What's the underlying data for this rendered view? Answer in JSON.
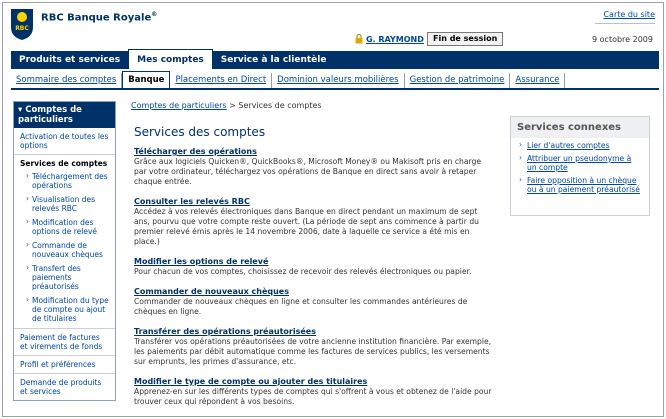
{
  "header": {
    "brand": "RBC Banque Royale",
    "brand_mark": "®",
    "logo_text": "RBC",
    "sitemap": "Carte du site",
    "user": "G. RAYMOND",
    "logout": "Fin de session",
    "date": "9 octobre 2009"
  },
  "colors": {
    "navy": "#003168",
    "link": "#0047a6",
    "logo_yellow": "#ffd200"
  },
  "main_tabs": [
    {
      "label": "Produits et services"
    },
    {
      "label": "Mes comptes"
    },
    {
      "label": "Service à la clientèle"
    }
  ],
  "sub_tabs": [
    {
      "label": "Sommaire des comptes"
    },
    {
      "label": "Banque"
    },
    {
      "label": "Placements en Direct"
    },
    {
      "label": "Dominion valeurs mobilières"
    },
    {
      "label": "Gestion de patrimoine"
    },
    {
      "label": "Assurance"
    }
  ],
  "leftnav": {
    "header": "Comptes de particuliers",
    "activation": "Activation de toutes les options",
    "current": "Services de comptes",
    "subitems": [
      "Téléchargement des opérations",
      "Visualisation des relevés RBC",
      "Modification des options de relevé",
      "Commande de nouveaux chèques",
      "Transfert des paiements préautorisés",
      "Modification du type de compte ou ajout de titulaires"
    ],
    "others": [
      "Paiement de factures et virements de fonds",
      "Profil et préférences",
      "Demande de produits et services"
    ]
  },
  "breadcrumb": {
    "link": "Comptes de particuliers",
    "sep": ">",
    "current": "Services de comptes"
  },
  "content": {
    "title": "Services des comptes",
    "sections": [
      {
        "link": "Télécharger des opérations",
        "text": "Grâce aux logiciels Quicken®, QuickBooks®, Microsoft Money® ou Makisoft pris en charge par votre ordinateur, téléchargez vos opérations de Banque en direct sans avoir à retaper chaque entrée."
      },
      {
        "link": "Consulter les relevés RBC",
        "text": "Accédez à vos relevés électroniques dans Banque en direct pendant un maximum de sept ans, pourvu que votre compte reste ouvert. (La période de sept ans commence à partir du premier relevé émis après le 14 novembre 2006, date à laquelle ce service a été mis en place.)"
      },
      {
        "link": "Modifier les options de relevé",
        "text": "Pour chacun de vos comptes, choisissez de recevoir des relevés électroniques ou papier."
      },
      {
        "link": "Commander de nouveaux chèques",
        "text": "Commander de nouveaux chèques en ligne et consulter les commandes antérieures de chèques en ligne."
      },
      {
        "link": "Transférer des opérations préautorisées",
        "text": "Transférer vos opérations préautorisées de votre ancienne institution financière. Par exemple, les paiements par débit automatique comme les factures de services publics, les versements sur emprunts, les primes d'assurance, etc."
      },
      {
        "link": "Modifier le type de compte ou ajouter des titulaires",
        "text": "Apprenez-en sur les différents types de comptes qui s'offrent à vous et obtenez de l'aide pour trouver ceux qui répondent à vos besoins."
      }
    ]
  },
  "related": {
    "title": "Services connexes",
    "links": [
      "Lier d'autres comptes",
      "Attribuer un pseudonyme à un compte",
      "Faire opposition à un chèque ou à un paiement préautorisé"
    ]
  }
}
